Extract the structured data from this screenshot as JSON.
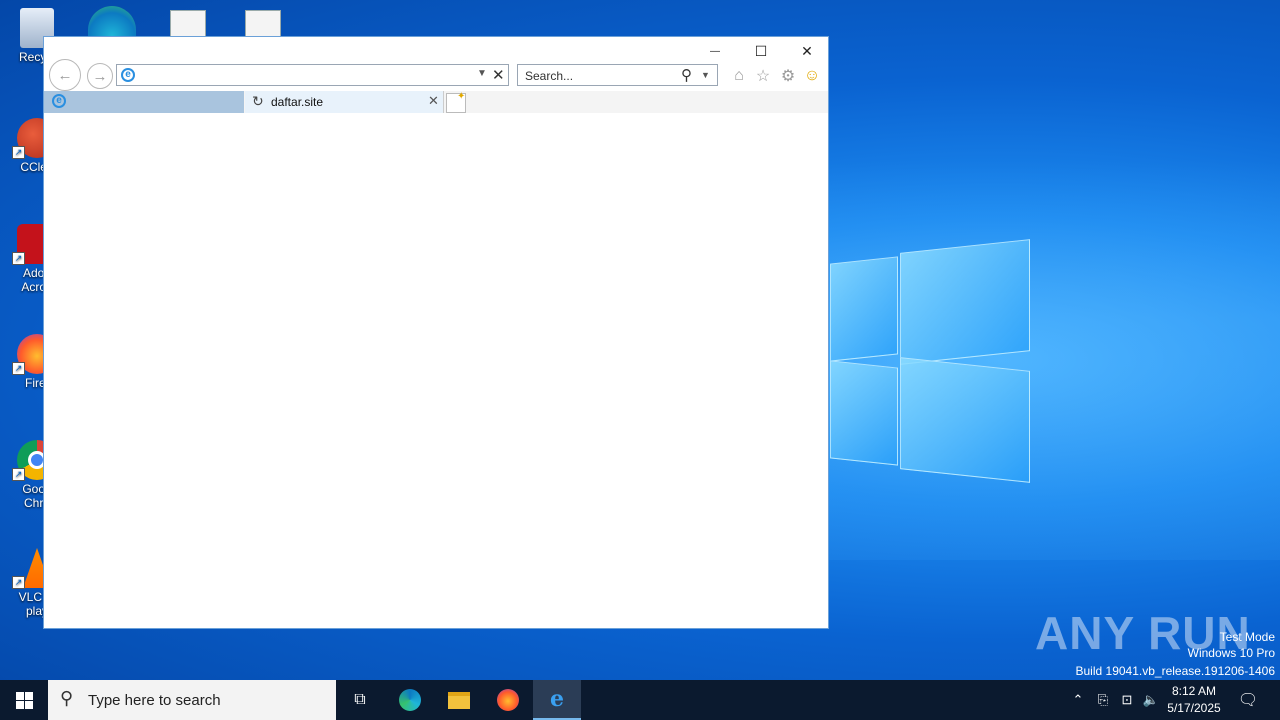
{
  "desktop": {
    "icons": [
      {
        "label": "Recycle Bin",
        "shown": "Recycl",
        "icon": "recycle-bin-icon"
      },
      {
        "label": "CCleaner",
        "shown": "CClea",
        "icon": "ccleaner-icon"
      },
      {
        "label": "Adobe Acrobat",
        "line1": "Adob",
        "line2": "Acrob",
        "icon": "acrobat-icon"
      },
      {
        "label": "Firefox",
        "shown": "Firef",
        "icon": "firefox-icon"
      },
      {
        "label": "Google Chrome",
        "line1": "Goog",
        "line2": "Chro",
        "icon": "chrome-icon"
      },
      {
        "label": "VLC media player",
        "line1": "VLC m",
        "line2": "play",
        "icon": "vlc-icon"
      }
    ]
  },
  "browser": {
    "address_value": "",
    "search_placeholder": "Search...",
    "tabs": [
      {
        "title": ""
      },
      {
        "title": "daftar.site"
      }
    ],
    "caption": {
      "minimize": "—",
      "maximize": "☐",
      "close": "✕"
    }
  },
  "watermark": {
    "brand": "ANY RUN",
    "line1": "Test Mode",
    "line2": "Windows 10 Pro",
    "line3": "Build 19041.vb_release.191206-1406"
  },
  "taskbar": {
    "search_placeholder": "Type here to search",
    "time": "8:12 AM",
    "date": "5/17/2025"
  },
  "colors": {
    "accent": "#0a63d1",
    "taskbar": "#0b1a2f",
    "tab_active": "#a9c4de"
  }
}
